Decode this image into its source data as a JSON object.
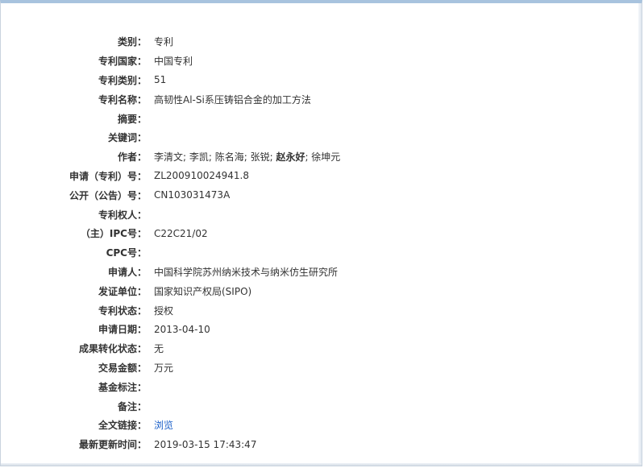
{
  "rows": [
    {
      "label": "类别：",
      "value": "专利"
    },
    {
      "label": "专利国家：",
      "value": "中国专利"
    },
    {
      "label": "专利类别：",
      "value": "51"
    },
    {
      "label": "专利名称：",
      "value": "高韧性Al-Si系压铸铝合金的加工方法"
    },
    {
      "label": "摘要：",
      "value": ""
    },
    {
      "label": "关键词：",
      "value": ""
    },
    {
      "label": "作者：",
      "value": ""
    },
    {
      "label": "申请（专利）号：",
      "value": "ZL200910024941.8"
    },
    {
      "label": "公开（公告）号：",
      "value": "CN103031473A"
    },
    {
      "label": "专利权人：",
      "value": ""
    },
    {
      "label": "（主）IPC号：",
      "value": "C22C21/02"
    },
    {
      "label": "CPC号：",
      "value": ""
    },
    {
      "label": "申请人：",
      "value": "中国科学院苏州纳米技术与纳米仿生研究所"
    },
    {
      "label": "发证单位：",
      "value": "国家知识产权局(SIPO)"
    },
    {
      "label": "专利状态：",
      "value": "授权"
    },
    {
      "label": "申请日期：",
      "value": "2013-04-10"
    },
    {
      "label": "成果转化状态：",
      "value": "无"
    },
    {
      "label": "交易金额：",
      "value": "万元"
    },
    {
      "label": "基金标注：",
      "value": ""
    },
    {
      "label": "备注：",
      "value": ""
    },
    {
      "label": "全文链接：",
      "value": "浏览"
    },
    {
      "label": "最新更新时间：",
      "value": "2019-03-15 17:43:47"
    }
  ],
  "authors": {
    "a1": "李清文; 李凯; 陈名海; 张锐; ",
    "a2": "赵永好",
    "a3": "; 徐坤元"
  }
}
